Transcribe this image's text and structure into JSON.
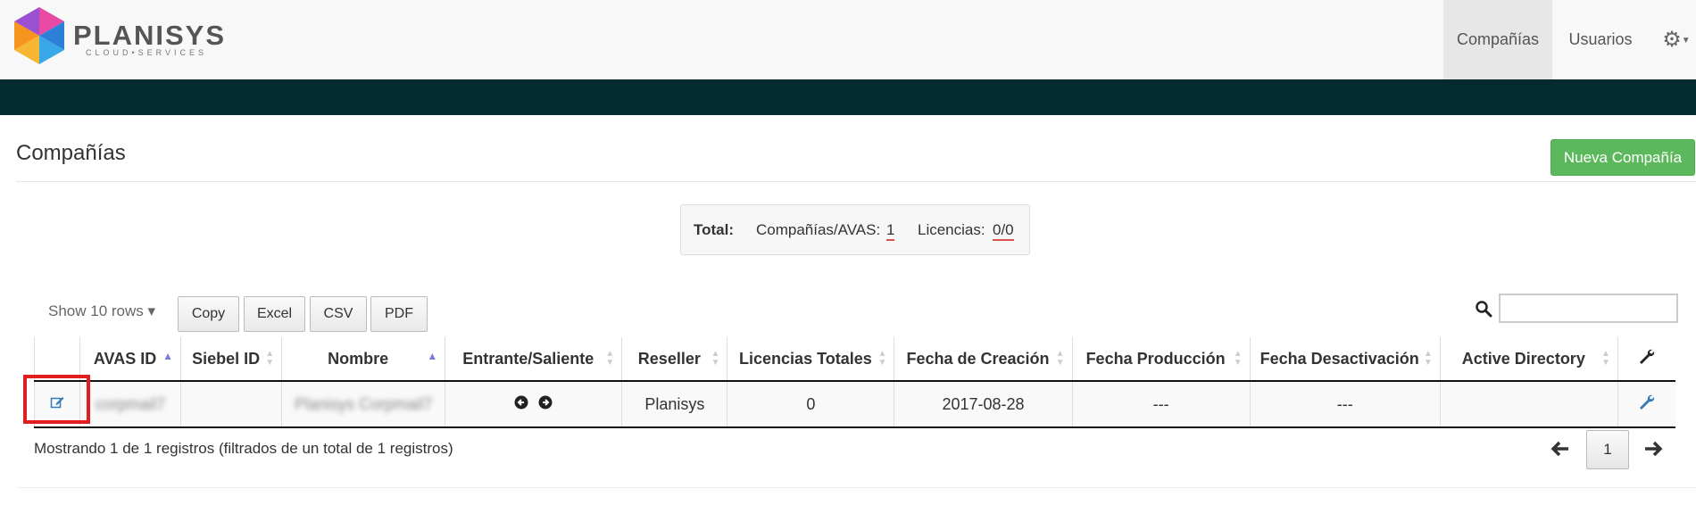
{
  "brand": {
    "name": "PLANISYS",
    "tagline": "CLOUD•SERVICES"
  },
  "nav": {
    "items": [
      "Compañías",
      "Usuarios"
    ],
    "active": "Compañías",
    "settings_icon": "gear-icon"
  },
  "page": {
    "title": "Compañías",
    "new_button": "Nueva Compañía"
  },
  "totals": {
    "label": "Total:",
    "companies_label": "Compañías/AVAS:",
    "companies_value": "1",
    "licenses_label": "Licencias:",
    "licenses_value": "0/0"
  },
  "toolbar": {
    "show_rows": "Show 10 rows ▾",
    "buttons": [
      "Copy",
      "Excel",
      "CSV",
      "PDF"
    ],
    "search_value": ""
  },
  "table": {
    "columns": [
      "AVAS ID",
      "Siebel ID",
      "Nombre",
      "Entrante/Saliente",
      "Reseller",
      "Licencias Totales",
      "Fecha de Creación",
      "Fecha Producción",
      "Fecha Desactivación",
      "Active Directory"
    ],
    "rows": [
      {
        "avas_id": "corpmail7",
        "siebel_id": "",
        "nombre": "Planisys Corpmail7",
        "reseller": "Planisys",
        "licencias": "0",
        "fecha_creacion": "2017-08-28",
        "fecha_produccion": "---",
        "fecha_desactivacion": "---",
        "active_directory": ""
      }
    ]
  },
  "footer": {
    "info": "Mostrando 1 de 1 registros (filtrados de un total de 1 registros)",
    "page": "1"
  },
  "colors": {
    "band": "#032b30",
    "success": "#5cb85c",
    "highlight": "#e21d1d",
    "link": "#337ab7"
  }
}
